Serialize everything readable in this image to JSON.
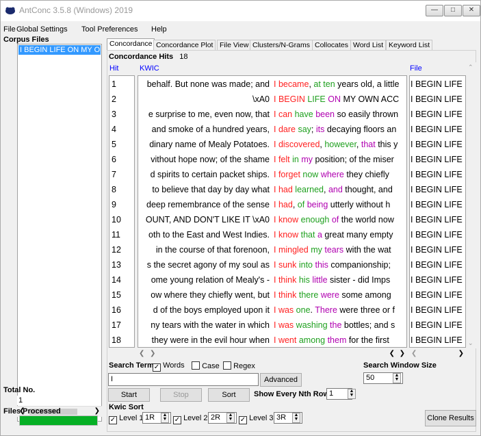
{
  "window": {
    "title": "AntConc 3.5.8 (Windows) 2019",
    "minimize_glyph": "—",
    "maximize_glyph": "□",
    "close_glyph": "✕"
  },
  "menu": [
    "File",
    "Global Settings",
    "Tool Preferences",
    "Help"
  ],
  "left_panel": {
    "corpus_files_label": "Corpus Files",
    "corpus_files": [
      "I BEGIN LIFE ON MY O"
    ],
    "total_no_label": "Total No.",
    "total_no_value": "1",
    "files_processed_label": "Files Processed",
    "files_processed_progress": 1.0
  },
  "tabs": [
    "Concordance",
    "Concordance Plot",
    "File View",
    "Clusters/N-Grams",
    "Collocates",
    "Word List",
    "Keyword List"
  ],
  "active_tab": "Concordance",
  "concordance": {
    "hits_label": "Concordance Hits",
    "hits_count": "18",
    "col_hit": "Hit",
    "col_kwic": "KWIC",
    "col_file": "File",
    "rows": [
      {
        "num": "1",
        "left": "behalf. But none was made; and",
        "kwic": [
          [
            "I ",
            "red"
          ],
          [
            "became",
            "red"
          ],
          [
            ", ",
            "plain"
          ],
          [
            "at ten",
            "green"
          ],
          [
            " years old, a little",
            "plain"
          ]
        ],
        "file": "I BEGIN LIFE"
      },
      {
        "num": "2",
        "left": "\\xA0",
        "kwic": [
          [
            "I ",
            "red"
          ],
          [
            "BEGIN",
            "red"
          ],
          [
            " ",
            "plain"
          ],
          [
            "LIFE",
            "green"
          ],
          [
            " ",
            "plain"
          ],
          [
            "ON",
            "purple"
          ],
          [
            " MY OWN ACC",
            "plain"
          ]
        ],
        "file": "I BEGIN LIFE"
      },
      {
        "num": "3",
        "left": "e surprise to me, even now, that",
        "kwic": [
          [
            "I ",
            "red"
          ],
          [
            "can",
            "red"
          ],
          [
            " ",
            "plain"
          ],
          [
            "have",
            "green"
          ],
          [
            " ",
            "plain"
          ],
          [
            "been",
            "purple"
          ],
          [
            " so easily thrown",
            "plain"
          ]
        ],
        "file": "I BEGIN LIFE"
      },
      {
        "num": "4",
        "left": "and smoke of a hundred years,",
        "kwic": [
          [
            "I ",
            "red"
          ],
          [
            "dare",
            "red"
          ],
          [
            " ",
            "plain"
          ],
          [
            "say",
            "green"
          ],
          [
            "; ",
            "plain"
          ],
          [
            "its",
            "purple"
          ],
          [
            " decaying floors an",
            "plain"
          ]
        ],
        "file": "I BEGIN LIFE"
      },
      {
        "num": "5",
        "left": "dinary name of Mealy Potatoes.",
        "kwic": [
          [
            "I ",
            "red"
          ],
          [
            "discovered",
            "red"
          ],
          [
            ", ",
            "plain"
          ],
          [
            "however",
            "green"
          ],
          [
            ", ",
            "plain"
          ],
          [
            "that",
            "purple"
          ],
          [
            " this y",
            "plain"
          ]
        ],
        "file": "I BEGIN LIFE"
      },
      {
        "num": "6",
        "left": "vithout hope now; of the shame",
        "kwic": [
          [
            "I ",
            "red"
          ],
          [
            "felt",
            "red"
          ],
          [
            " ",
            "plain"
          ],
          [
            "in",
            "green"
          ],
          [
            " ",
            "plain"
          ],
          [
            "my",
            "purple"
          ],
          [
            " position; of the miser",
            "plain"
          ]
        ],
        "file": "I BEGIN LIFE"
      },
      {
        "num": "7",
        "left": "d spirits to certain packet ships.",
        "kwic": [
          [
            "I ",
            "red"
          ],
          [
            "forget",
            "red"
          ],
          [
            " ",
            "plain"
          ],
          [
            "now",
            "green"
          ],
          [
            " ",
            "plain"
          ],
          [
            "where",
            "purple"
          ],
          [
            " they chiefly",
            "plain"
          ]
        ],
        "file": "I BEGIN LIFE"
      },
      {
        "num": "8",
        "left": "to believe that day by day what",
        "kwic": [
          [
            "I ",
            "red"
          ],
          [
            "had",
            "red"
          ],
          [
            " ",
            "plain"
          ],
          [
            "learned",
            "green"
          ],
          [
            ", ",
            "plain"
          ],
          [
            "and",
            "purple"
          ],
          [
            " thought, and",
            "plain"
          ]
        ],
        "file": "I BEGIN LIFE"
      },
      {
        "num": "9",
        "left": "deep remembrance of the sense",
        "kwic": [
          [
            "I ",
            "red"
          ],
          [
            "had",
            "red"
          ],
          [
            ", ",
            "plain"
          ],
          [
            "of",
            "green"
          ],
          [
            " ",
            "plain"
          ],
          [
            "being",
            "purple"
          ],
          [
            " utterly without h",
            "plain"
          ]
        ],
        "file": "I BEGIN LIFE"
      },
      {
        "num": "10",
        "left": "OUNT, AND DON'T LIKE IT \\xA0",
        "kwic": [
          [
            "I ",
            "red"
          ],
          [
            "know",
            "red"
          ],
          [
            " ",
            "plain"
          ],
          [
            "enough",
            "green"
          ],
          [
            " ",
            "plain"
          ],
          [
            "of",
            "purple"
          ],
          [
            " the world now",
            "plain"
          ]
        ],
        "file": "I BEGIN LIFE"
      },
      {
        "num": "11",
        "left": "oth to the East and West Indies.",
        "kwic": [
          [
            "I ",
            "red"
          ],
          [
            "know",
            "red"
          ],
          [
            " ",
            "plain"
          ],
          [
            "that",
            "green"
          ],
          [
            " ",
            "plain"
          ],
          [
            "a",
            "purple"
          ],
          [
            " great many empty",
            "plain"
          ]
        ],
        "file": "I BEGIN LIFE"
      },
      {
        "num": "12",
        "left": "in the course of that forenoon,",
        "kwic": [
          [
            "I ",
            "red"
          ],
          [
            "mingled",
            "red"
          ],
          [
            " ",
            "plain"
          ],
          [
            "my",
            "green"
          ],
          [
            " ",
            "plain"
          ],
          [
            "tears",
            "purple"
          ],
          [
            " with the wat",
            "plain"
          ]
        ],
        "file": "I BEGIN LIFE"
      },
      {
        "num": "13",
        "left": "s the secret agony of my soul as",
        "kwic": [
          [
            "I ",
            "red"
          ],
          [
            "sunk",
            "red"
          ],
          [
            " ",
            "plain"
          ],
          [
            "into",
            "green"
          ],
          [
            " ",
            "plain"
          ],
          [
            "this",
            "purple"
          ],
          [
            " companionship;",
            "plain"
          ]
        ],
        "file": "I BEGIN LIFE"
      },
      {
        "num": "14",
        "left": "ome young relation of Mealy's -",
        "kwic": [
          [
            "I ",
            "red"
          ],
          [
            "think",
            "red"
          ],
          [
            " ",
            "plain"
          ],
          [
            "his",
            "green"
          ],
          [
            " ",
            "plain"
          ],
          [
            "little",
            "purple"
          ],
          [
            " sister - did Imps",
            "plain"
          ]
        ],
        "file": "I BEGIN LIFE"
      },
      {
        "num": "15",
        "left": "ow where they chiefly went, but",
        "kwic": [
          [
            "I ",
            "red"
          ],
          [
            "think",
            "red"
          ],
          [
            " ",
            "plain"
          ],
          [
            "there",
            "green"
          ],
          [
            " ",
            "plain"
          ],
          [
            "were",
            "purple"
          ],
          [
            " some among",
            "plain"
          ]
        ],
        "file": "I BEGIN LIFE"
      },
      {
        "num": "16",
        "left": "d of the boys employed upon it",
        "kwic": [
          [
            "I ",
            "red"
          ],
          [
            "was",
            "red"
          ],
          [
            " ",
            "plain"
          ],
          [
            "one",
            "green"
          ],
          [
            ".  ",
            "plain"
          ],
          [
            "There",
            "purple"
          ],
          [
            " were three or f",
            "plain"
          ]
        ],
        "file": "I BEGIN LIFE"
      },
      {
        "num": "17",
        "left": "ny tears with the water in which",
        "kwic": [
          [
            "I ",
            "red"
          ],
          [
            "was",
            "red"
          ],
          [
            " ",
            "plain"
          ],
          [
            "washing",
            "green"
          ],
          [
            " ",
            "plain"
          ],
          [
            "the",
            "purple"
          ],
          [
            " bottles; and s",
            "plain"
          ]
        ],
        "file": "I BEGIN LIFE"
      },
      {
        "num": "18",
        "left": "they were in the evil hour when",
        "kwic": [
          [
            "I ",
            "red"
          ],
          [
            "went",
            "red"
          ],
          [
            " ",
            "plain"
          ],
          [
            "among",
            "green"
          ],
          [
            " ",
            "plain"
          ],
          [
            "them",
            "purple"
          ],
          [
            " for the first",
            "plain"
          ]
        ],
        "file": "I BEGIN LIFE"
      }
    ]
  },
  "search": {
    "search_term_label": "Search Term",
    "words_label": "Words",
    "case_label": "Case",
    "regex_label": "Regex",
    "words_checked": true,
    "case_checked": false,
    "regex_checked": false,
    "query": "I",
    "advanced_label": "Advanced",
    "window_size_label": "Search Window Size",
    "window_size": "50"
  },
  "controls": {
    "start_label": "Start",
    "stop_label": "Stop",
    "sort_label": "Sort",
    "nth_row_label": "Show Every Nth Row",
    "nth_row_value": "1",
    "kwic_sort_label": "Kwic Sort",
    "level1_label": "Level 1",
    "level1_value": "1R",
    "level2_label": "Level 2",
    "level2_value": "2R",
    "level3_label": "Level 3",
    "level3_value": "3R",
    "clone_label": "Clone Results"
  },
  "colors": {
    "red": "#ff2020",
    "green": "#1fa01f",
    "purple": "#b000b0",
    "selection": "#3399ff",
    "progress": "#06b025"
  }
}
